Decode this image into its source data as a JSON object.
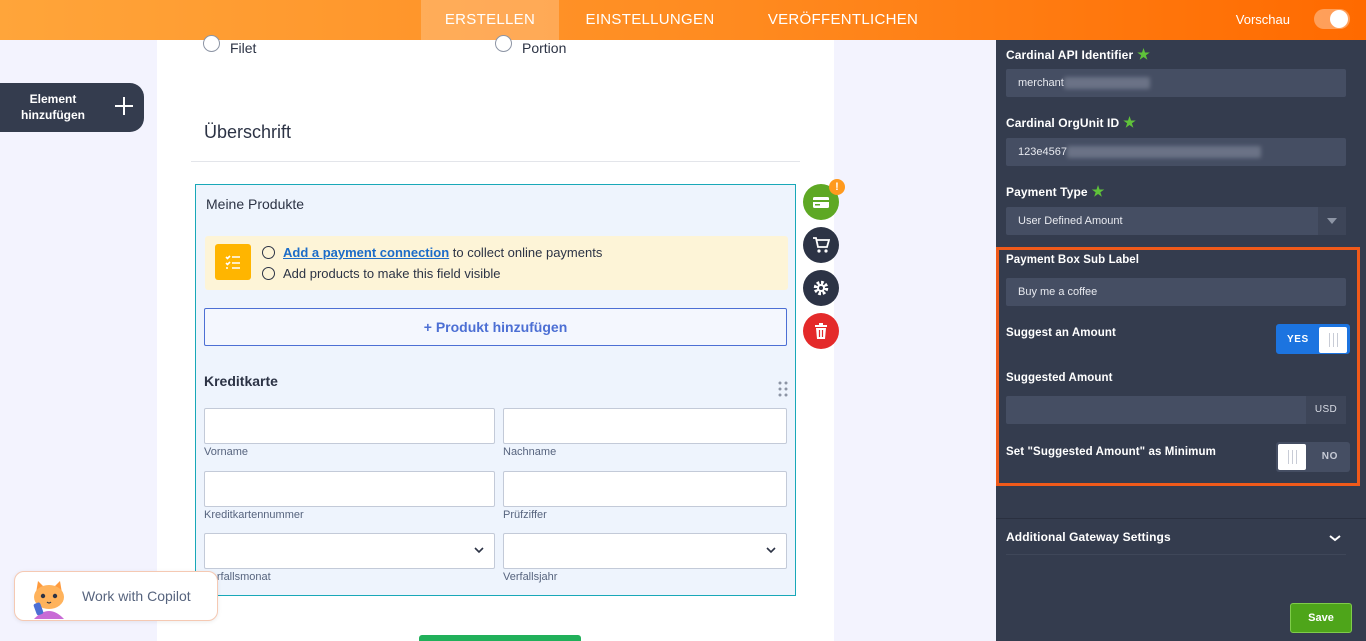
{
  "topbar": {
    "tabs": [
      {
        "label": "ERSTELLEN",
        "active": true
      },
      {
        "label": "EINSTELLUNGEN",
        "active": false
      },
      {
        "label": "VERÖFFENTLICHEN",
        "active": false
      }
    ],
    "preview_label": "Vorschau",
    "preview_on": false
  },
  "add_element": {
    "label": "Element hinzufügen",
    "icon": "plus-icon"
  },
  "form": {
    "radio_options": [
      "Filet",
      "Portion"
    ],
    "heading": "Überschrift",
    "product_field": {
      "title": "Meine Produkte",
      "warning_link": "Add a payment connection",
      "warning_line1_rest": " to collect online payments",
      "warning_line2": "Add products to make this field visible",
      "add_product_label": "+ Produkt hinzufügen"
    },
    "credit_card": {
      "title": "Kreditkarte",
      "first_name_label": "Vorname",
      "last_name_label": "Nachname",
      "card_number_label": "Kreditkartennummer",
      "cvv_label": "Prüfziffer",
      "expiry_month_label": "Verfallsmonat",
      "expiry_year_label": "Verfallsjahr"
    },
    "side_tools": {
      "badge": "!"
    }
  },
  "copilot": {
    "label": "Work with Copilot"
  },
  "panel": {
    "api_identifier_label": "Cardinal API Identifier",
    "api_identifier_value": "merchant",
    "orgunit_label": "Cardinal OrgUnit ID",
    "orgunit_value": "123e4567",
    "payment_type_label": "Payment Type",
    "payment_type_value": "User Defined Amount",
    "sub_label_label": "Payment Box Sub Label",
    "sub_label_value": "Buy me a coffee",
    "suggest_label": "Suggest an Amount",
    "suggest_toggle": "YES",
    "suggested_amount_label": "Suggested Amount",
    "suggested_amount_value": "",
    "currency": "USD",
    "minimum_label": "Set \"Suggested Amount\" as Minimum",
    "minimum_toggle": "NO",
    "additional_label": "Additional Gateway Settings",
    "save_label": "Save"
  },
  "colors": {
    "accent_orange": "#ff8a1f",
    "highlight_border": "#f05a1a",
    "panel_bg": "#343c4e",
    "toggle_blue": "#1c74e0",
    "save_green": "#4ea51a"
  }
}
